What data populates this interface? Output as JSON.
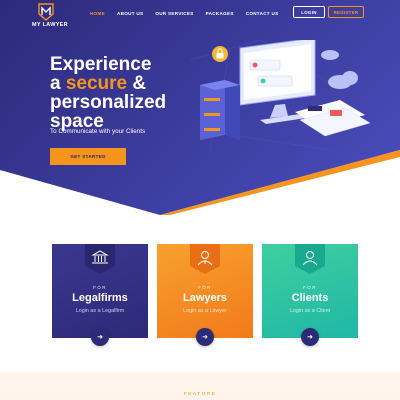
{
  "brand": {
    "name": "MY LAWYER",
    "accent": "#f7941d",
    "primary": "#2d2a78"
  },
  "nav": {
    "items": [
      {
        "label": "HOME",
        "active": true
      },
      {
        "label": "ABOUT US",
        "active": false
      },
      {
        "label": "OUR SERVICES",
        "active": false
      },
      {
        "label": "PACKAGES",
        "active": false
      },
      {
        "label": "CONTACT US",
        "active": false
      }
    ],
    "login_label": "LOGIN",
    "register_label": "REGISTER"
  },
  "hero": {
    "headline_part1": "Experience",
    "headline_part2": "a",
    "headline_accent": "secure",
    "headline_part3": "&",
    "headline_part4": "personalized",
    "headline_part5": "space",
    "subtitle": "To Communicate with your Clients",
    "cta_label": "GET STARTED"
  },
  "cards": [
    {
      "for_label": "FOR",
      "title": "Legalfirms",
      "subtitle": "Login as a Legalfirm",
      "icon": "courthouse-icon",
      "color": "#2d2a78"
    },
    {
      "for_label": "FOR",
      "title": "Lawyers",
      "subtitle": "Login as a Lawyer",
      "icon": "lawyer-icon",
      "color": "#f7941d"
    },
    {
      "for_label": "FOR",
      "title": "Clients",
      "subtitle": "Login as a Client",
      "icon": "client-icon",
      "color": "#2fc4a4"
    }
  ],
  "features": {
    "label": "FEATURE"
  }
}
